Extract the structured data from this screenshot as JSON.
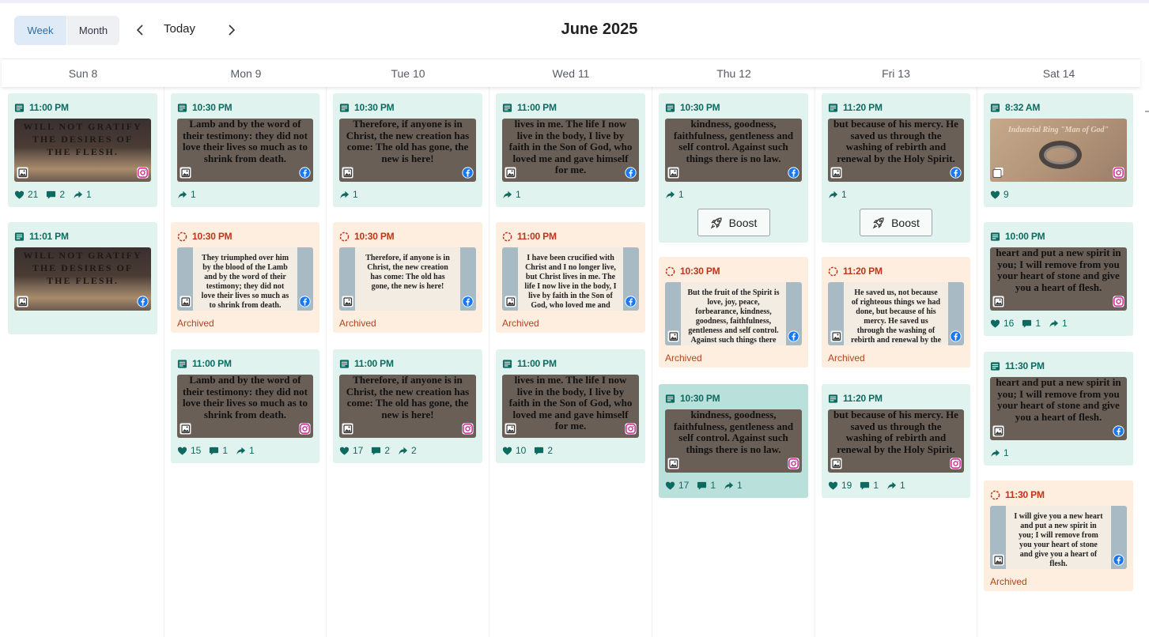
{
  "toolbar": {
    "views": [
      "Week",
      "Month"
    ],
    "active_view": "Week",
    "today_label": "Today",
    "title": "June 2025"
  },
  "days": [
    "Sun 8",
    "Mon 9",
    "Tue 10",
    "Wed 11",
    "Thu 12",
    "Fri 13",
    "Sat 14"
  ],
  "labels": {
    "archived": "Archived",
    "boost": "Boost"
  },
  "colors": {
    "published_bg": "#e1f3ee",
    "published_selected_bg": "#b9e0db",
    "archived_bg": "#fdeedf",
    "published_text": "#0e6a60",
    "archived_text": "#c0341a",
    "active_view_bg": "#deeaf5"
  },
  "posts": [
    {
      "day": 0,
      "status": "published",
      "time": "11:00 PM",
      "image": "mountain",
      "media": "image",
      "network": "instagram",
      "text": "WILL NOT GRATIFY THE DESIRES OF THE FLESH.",
      "likes": "21",
      "comments": "2",
      "shares": "1"
    },
    {
      "day": 0,
      "status": "published",
      "time": "11:01 PM",
      "image": "mountain",
      "media": "image",
      "network": "facebook",
      "text": "WILL NOT GRATIFY THE DESIRES OF THE FLESH."
    },
    {
      "day": 1,
      "status": "published",
      "time": "10:30 PM",
      "image": "dark",
      "media": "image",
      "network": "facebook",
      "text": "Lamb and by the word of their testimony: they did not love their lives so much as to shrink from death.",
      "shares": "1"
    },
    {
      "day": 1,
      "status": "archived",
      "time": "10:30 PM",
      "image": "light",
      "media": "image",
      "network": "facebook",
      "text": "They triumphed over him by the blood of the Lamb and by the word of their testimony; they did not love their lives so much as to shrink from death."
    },
    {
      "day": 1,
      "status": "published",
      "time": "11:00 PM",
      "image": "dark",
      "media": "image",
      "network": "instagram",
      "text": "Lamb and by the word of their testimony: they did not love their lives so much as to shrink from death.",
      "likes": "15",
      "comments": "1",
      "shares": "1"
    },
    {
      "day": 2,
      "status": "published",
      "time": "10:30 PM",
      "image": "dark",
      "media": "image",
      "network": "facebook",
      "text": "Therefore, if anyone is in Christ, the new creation has come: The old has gone, the new is here!",
      "shares": "1"
    },
    {
      "day": 2,
      "status": "archived",
      "time": "10:30 PM",
      "image": "light",
      "media": "image",
      "network": "facebook",
      "text": "Therefore, if anyone is in Christ, the new creation has come: The old has gone, the new is here!"
    },
    {
      "day": 2,
      "status": "published",
      "time": "11:00 PM",
      "image": "dark",
      "media": "image",
      "network": "instagram",
      "text": "Therefore, if anyone is in Christ, the new creation has come: The old has gone, the new is here!",
      "likes": "17",
      "comments": "2",
      "shares": "2"
    },
    {
      "day": 3,
      "status": "published",
      "time": "11:00 PM",
      "image": "dark",
      "media": "image",
      "network": "facebook",
      "text": "lives in me. The life I now live in the body, I live by faith in the Son of God, who loved me and gave himself for me.",
      "shares": "1"
    },
    {
      "day": 3,
      "status": "archived",
      "time": "11:00 PM",
      "image": "light",
      "media": "image",
      "network": "facebook",
      "text": "I have been crucified with Christ and I no longer live, but Christ lives in me. The life I now live in the body, I live by faith in the Son of God, who loved me and gave himself for me."
    },
    {
      "day": 3,
      "status": "published",
      "time": "11:00 PM",
      "image": "dark",
      "media": "image",
      "network": "instagram",
      "text": "lives in me. The life I now live in the body, I live by faith in the Son of God, who loved me and gave himself for me.",
      "likes": "10",
      "comments": "2"
    },
    {
      "day": 4,
      "status": "published",
      "time": "10:30 PM",
      "image": "dark",
      "media": "image",
      "network": "facebook",
      "text": "kindness, goodness, faithfulness, gentleness and self control. Against such things there is no law.",
      "shares": "1",
      "boost": true
    },
    {
      "day": 4,
      "status": "archived",
      "time": "10:30 PM",
      "image": "light",
      "media": "image",
      "network": "facebook",
      "text": "But the fruit of the Spirit is love, joy, peace, forbearance, kindness, goodness, faithfulness, gentleness and self control. Against such things there is no law."
    },
    {
      "day": 4,
      "status": "published",
      "time": "10:30 PM",
      "image": "dark",
      "media": "image",
      "network": "instagram",
      "selected": true,
      "text": "kindness, goodness, faithfulness, gentleness and self control. Against such things there is no law.",
      "likes": "17",
      "comments": "1",
      "shares": "1"
    },
    {
      "day": 5,
      "status": "published",
      "time": "11:20 PM",
      "image": "dark",
      "media": "image",
      "network": "facebook",
      "text": "but because of his mercy. He saved us through the washing of rebirth and renewal by the Holy Spirit.",
      "shares": "1",
      "boost": true
    },
    {
      "day": 5,
      "status": "archived",
      "time": "11:20 PM",
      "image": "light",
      "media": "image",
      "network": "facebook",
      "text": "He saved us, not because of righteous things we had done, but because of his mercy. He saved us through the washing of rebirth and renewal by the Holy Spirit."
    },
    {
      "day": 5,
      "status": "published",
      "time": "11:20 PM",
      "image": "dark",
      "media": "image",
      "network": "instagram",
      "text": "but because of his mercy. He saved us through the washing of rebirth and renewal by the Holy Spirit.",
      "likes": "19",
      "comments": "1",
      "shares": "1"
    },
    {
      "day": 6,
      "status": "published",
      "time": "8:32 AM",
      "image": "ring",
      "media": "carousel",
      "network": "instagram",
      "text": "Industrial Ring \"Man of God\"",
      "likes": "9"
    },
    {
      "day": 6,
      "status": "published",
      "time": "10:00 PM",
      "image": "dark",
      "media": "image",
      "network": "instagram",
      "text": "heart and put a new spirit in you; I will remove from you your heart of stone and give you a heart of flesh.",
      "likes": "16",
      "comments": "1",
      "shares": "1"
    },
    {
      "day": 6,
      "status": "published",
      "time": "11:30 PM",
      "image": "dark",
      "media": "image",
      "network": "facebook",
      "text": "heart and put a new spirit in you; I will remove from you your heart of stone and give you a heart of flesh.",
      "shares": "1"
    },
    {
      "day": 6,
      "status": "archived",
      "time": "11:30 PM",
      "image": "light",
      "media": "image",
      "network": "facebook",
      "text": "I will give you a new heart and put a new spirit in you; I will remove from you your heart of stone and give you a heart of flesh."
    }
  ]
}
